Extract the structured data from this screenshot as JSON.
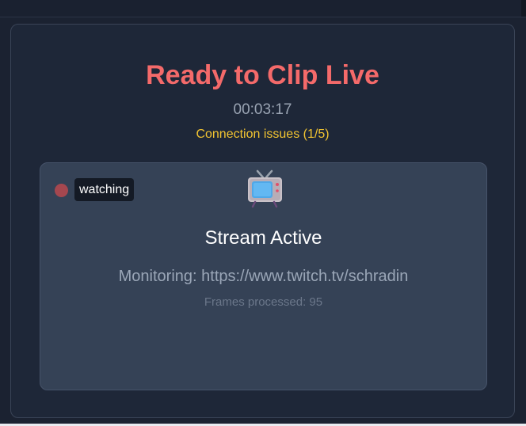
{
  "app": {
    "title": "Ready to Clip Live",
    "timer": "00:03:17",
    "connection_warning": "Connection issues (1/5)"
  },
  "preview": {
    "status_label": "watching",
    "status_icon": "recording-dot-icon",
    "tv_icon": "television-icon",
    "stream_status": "Stream Active",
    "monitoring_text": "Monitoring: https://www.twitch.tv/schradin",
    "frames_text": "Frames processed: 95"
  },
  "colors": {
    "title": "#f46a6a",
    "warning": "#f2c431",
    "status_dot": "#a5474f",
    "panel_bg": "#1e2738",
    "preview_bg": "#354256"
  }
}
